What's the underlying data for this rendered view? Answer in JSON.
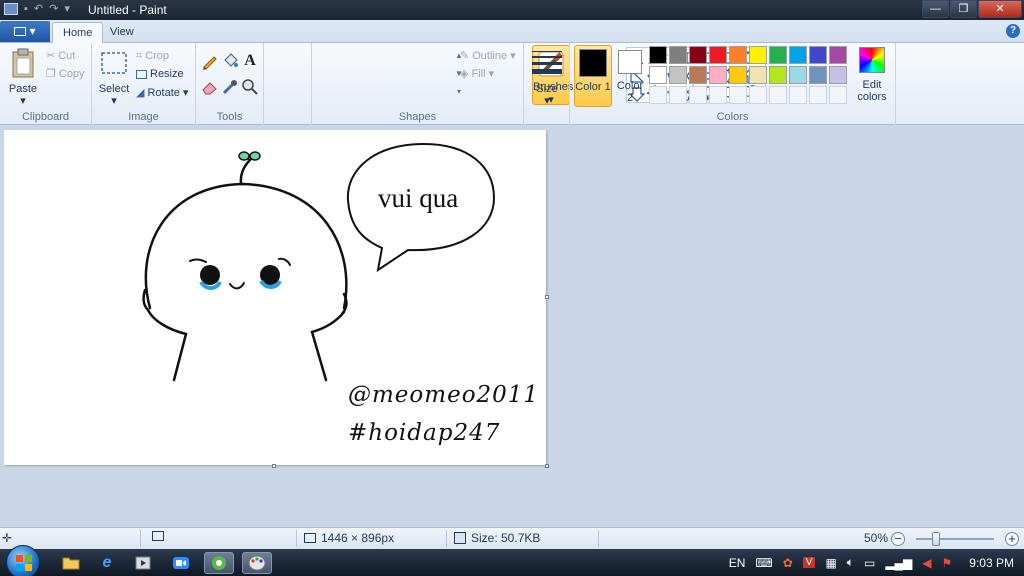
{
  "window": {
    "title": "Untitled - Paint",
    "buttons": {
      "minimize": "—",
      "restore": "❐",
      "close": "✕"
    }
  },
  "tabs": [
    {
      "label": "Home",
      "active": true
    },
    {
      "label": "View",
      "active": false
    }
  ],
  "app_menu_label": "▾",
  "help_label": "?",
  "ribbon": {
    "clipboard": {
      "label": "Clipboard",
      "paste": "Paste",
      "cut": "Cut",
      "copy": "Copy"
    },
    "image": {
      "label": "Image",
      "select": "Select",
      "crop": "Crop",
      "resize": "Resize",
      "rotate": "Rotate"
    },
    "tools": {
      "label": "Tools"
    },
    "brushes": {
      "label": "Brushes"
    },
    "shapes": {
      "label": "Shapes",
      "outline": "Outline",
      "fill": "Fill"
    },
    "size": {
      "label": "Size"
    },
    "colors": {
      "label": "Colors",
      "color1": "Color 1",
      "color2": "Color 2",
      "edit": "Edit colors",
      "color1_value": "#000000",
      "color2_value": "#ffffff",
      "palette_row1": [
        "#000000",
        "#7f7f7f",
        "#880015",
        "#ed1c24",
        "#ff7f27",
        "#fff200",
        "#22b14c",
        "#00a2e8",
        "#3f48cc",
        "#a349a4"
      ],
      "palette_row2": [
        "#ffffff",
        "#c3c3c3",
        "#b97a57",
        "#ffaec9",
        "#ffc90e",
        "#efe4b0",
        "#b5e61d",
        "#99d9ea",
        "#7092be",
        "#c8bfe7"
      ],
      "custom_slots": 10
    }
  },
  "canvas": {
    "speech_bubble_text": "vui qua",
    "signature_line1": "@meomeo2011",
    "signature_line2": "#hoidap247",
    "accent_sprout": "#6fd6a8",
    "tear_color": "#2aa0e0"
  },
  "status": {
    "dimensions": "1446 × 896px",
    "size": "Size: 50.7KB",
    "zoom": "50%"
  },
  "taskbar": {
    "language": "EN",
    "clock": "9:03 PM"
  }
}
